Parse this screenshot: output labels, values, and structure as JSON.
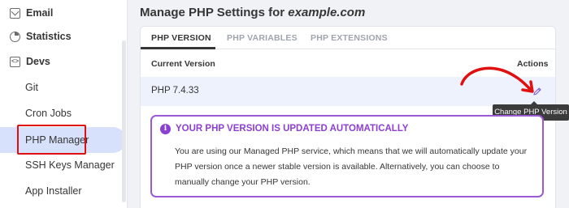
{
  "sidebar": {
    "items": [
      {
        "label": "Email",
        "icon": "mail-icon",
        "level": "top"
      },
      {
        "label": "Statistics",
        "icon": "pie-chart-icon",
        "level": "top"
      },
      {
        "label": "Devs",
        "icon": "code-icon",
        "level": "top"
      },
      {
        "label": "Git",
        "level": "sub"
      },
      {
        "label": "Cron Jobs",
        "level": "sub"
      },
      {
        "label": "PHP Manager",
        "level": "sub",
        "active": true
      },
      {
        "label": "SSH Keys Manager",
        "level": "sub"
      },
      {
        "label": "App Installer",
        "level": "sub"
      }
    ]
  },
  "page": {
    "title_prefix": "Manage PHP Settings for ",
    "domain": "example.com"
  },
  "tabs": [
    {
      "label": "PHP VERSION",
      "active": true
    },
    {
      "label": "PHP VARIABLES",
      "active": false
    },
    {
      "label": "PHP EXTENSIONS",
      "active": false
    }
  ],
  "table": {
    "headers": {
      "current_version": "Current Version",
      "actions": "Actions"
    },
    "rows": [
      {
        "version": "PHP 7.4.33",
        "action_icon": "pencil-icon"
      }
    ]
  },
  "tooltip": {
    "text": "Change PHP Version"
  },
  "notice": {
    "icon": "info-icon",
    "title": "YOUR PHP VERSION IS UPDATED AUTOMATICALLY",
    "body": "You are using our Managed PHP service, which means that we will automatically update your PHP version once a newer stable version is available. Alternatively, you can choose to manually change your PHP version."
  },
  "colors": {
    "accent_purple": "#8c3fd3",
    "active_nav_bg": "#d8e1fb",
    "annotation_red": "#e01010"
  }
}
